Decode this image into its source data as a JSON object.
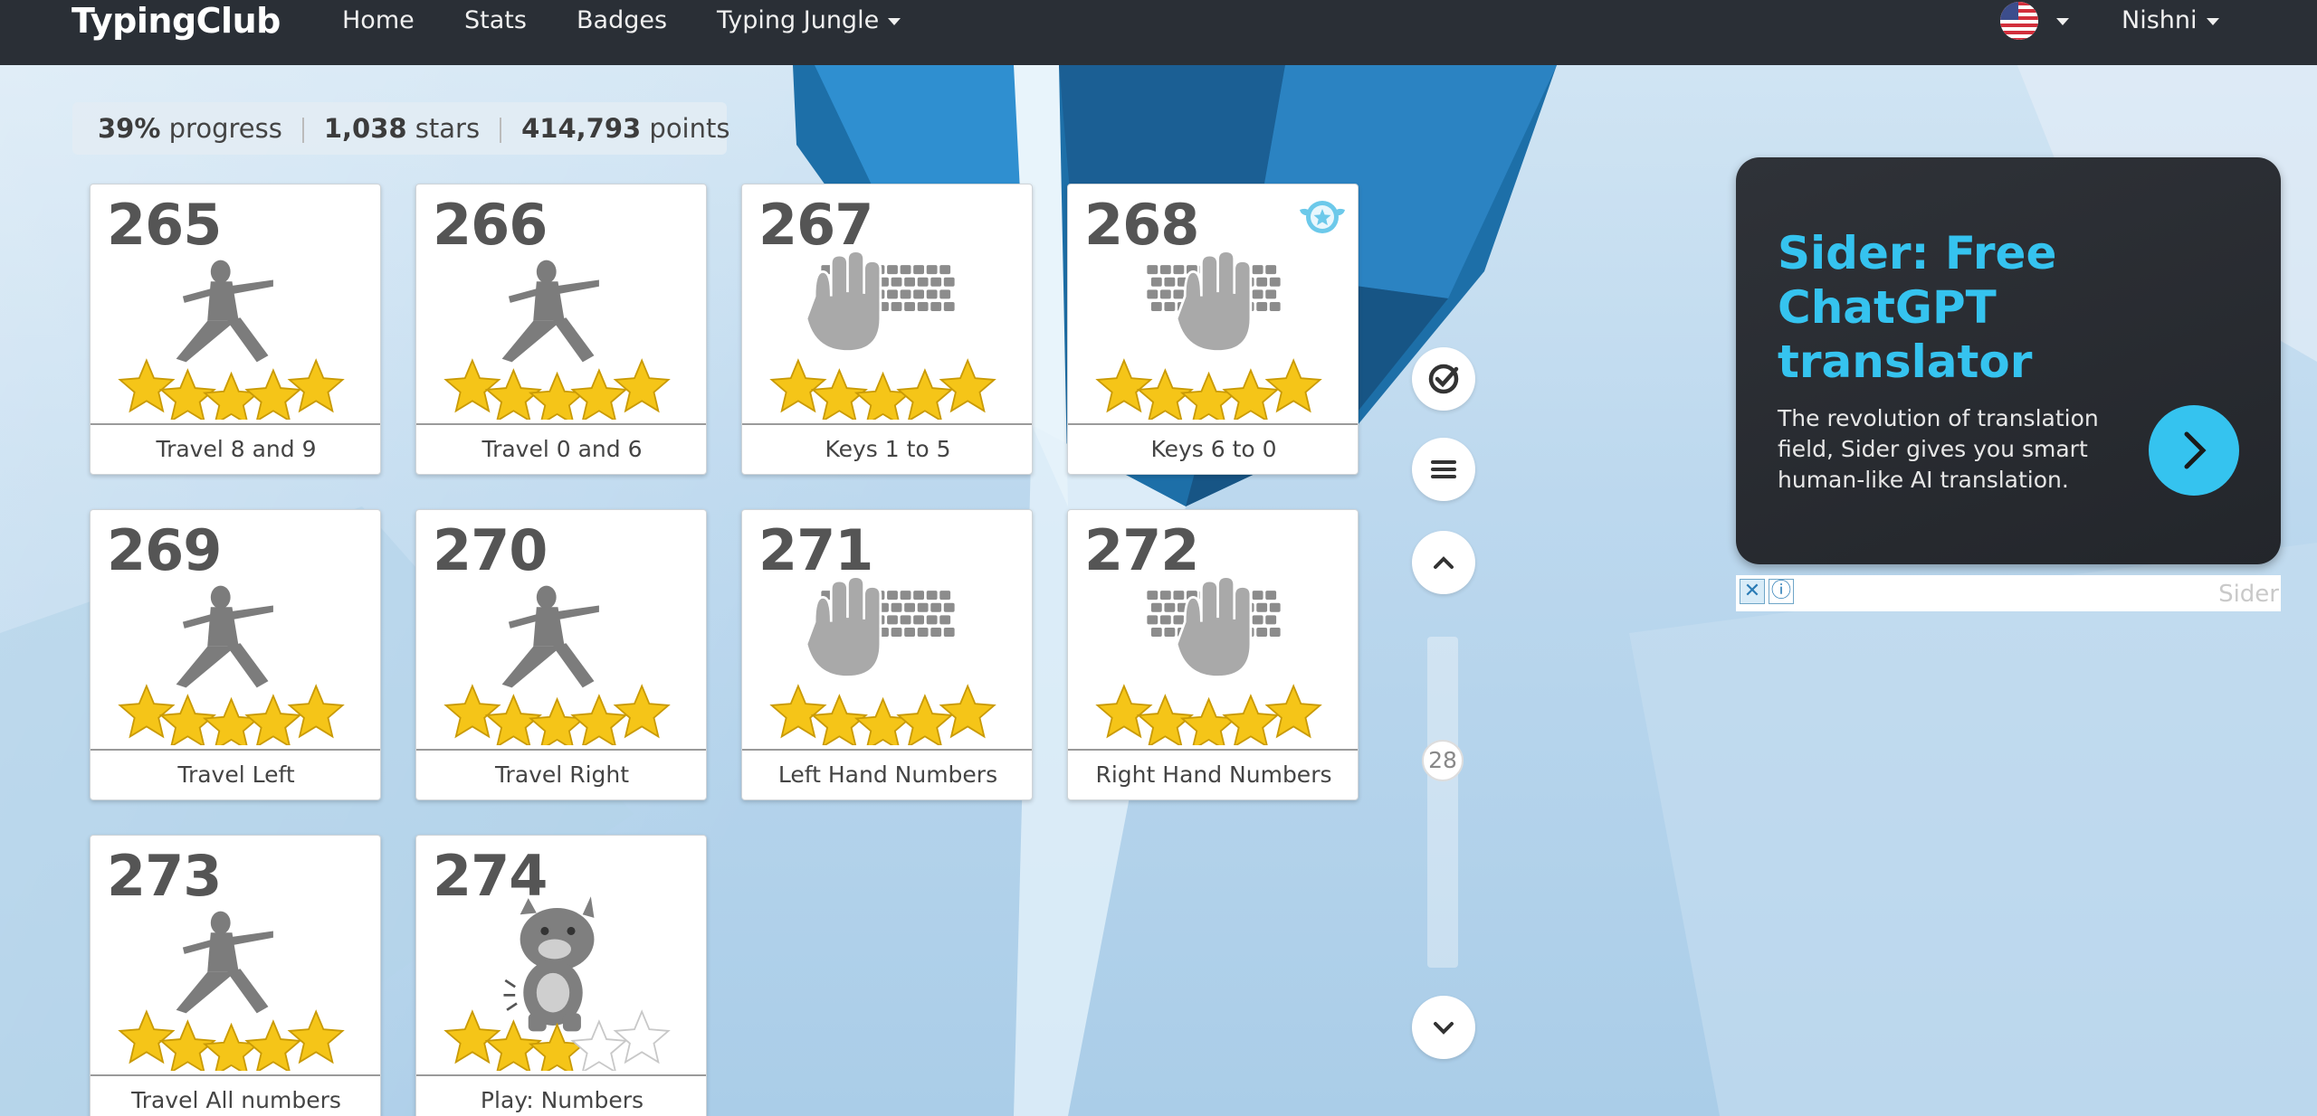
{
  "nav": {
    "logo": "TypingClub",
    "links": [
      "Home",
      "Stats",
      "Badges",
      "Typing Jungle"
    ],
    "user": "Nishni"
  },
  "progress": {
    "percent": "39%",
    "percent_label": "progress",
    "stars": "1,038",
    "stars_label": "stars",
    "points": "414,793",
    "points_label": "points"
  },
  "lessons": [
    {
      "number": "265",
      "label": "Travel 8 and 9",
      "art": "yoga-pose",
      "stars": 5
    },
    {
      "number": "266",
      "label": "Travel 0 and 6",
      "art": "yoga-pose",
      "stars": 5
    },
    {
      "number": "267",
      "label": "Keys 1 to 5",
      "art": "keyboard-left-hand",
      "stars": 5
    },
    {
      "number": "268",
      "label": "Keys 6 to 0",
      "art": "keyboard-right-hand",
      "stars": 5,
      "badge": "star-badge"
    },
    {
      "number": "269",
      "label": "Travel Left",
      "art": "yoga-pose",
      "stars": 5
    },
    {
      "number": "270",
      "label": "Travel Right",
      "art": "yoga-pose",
      "stars": 5
    },
    {
      "number": "271",
      "label": "Left Hand Numbers",
      "art": "keyboard-left-hand",
      "stars": 5
    },
    {
      "number": "272",
      "label": "Right Hand Numbers",
      "art": "keyboard-right-hand",
      "stars": 5
    },
    {
      "number": "273",
      "label": "Travel All numbers",
      "art": "yoga-pose",
      "stars": 5
    },
    {
      "number": "274",
      "label": "Play: Numbers",
      "art": "monster-game",
      "stars": 3
    }
  ],
  "controls": {
    "scroll_position": "28",
    "icons": [
      "check-circle-icon",
      "menu-icon",
      "chevron-up-icon",
      "chevron-down-icon"
    ]
  },
  "ad": {
    "title": "Sider: Free ChatGPT translator",
    "body": "The revolution of translation field, Sider gives you smart human-like AI translation.",
    "brand": "Sider",
    "close": "✕",
    "info": "ⓘ"
  },
  "colors": {
    "nav_bg": "#2a2f36",
    "star": "#f5c518",
    "ad_accent": "#35c3ef"
  }
}
